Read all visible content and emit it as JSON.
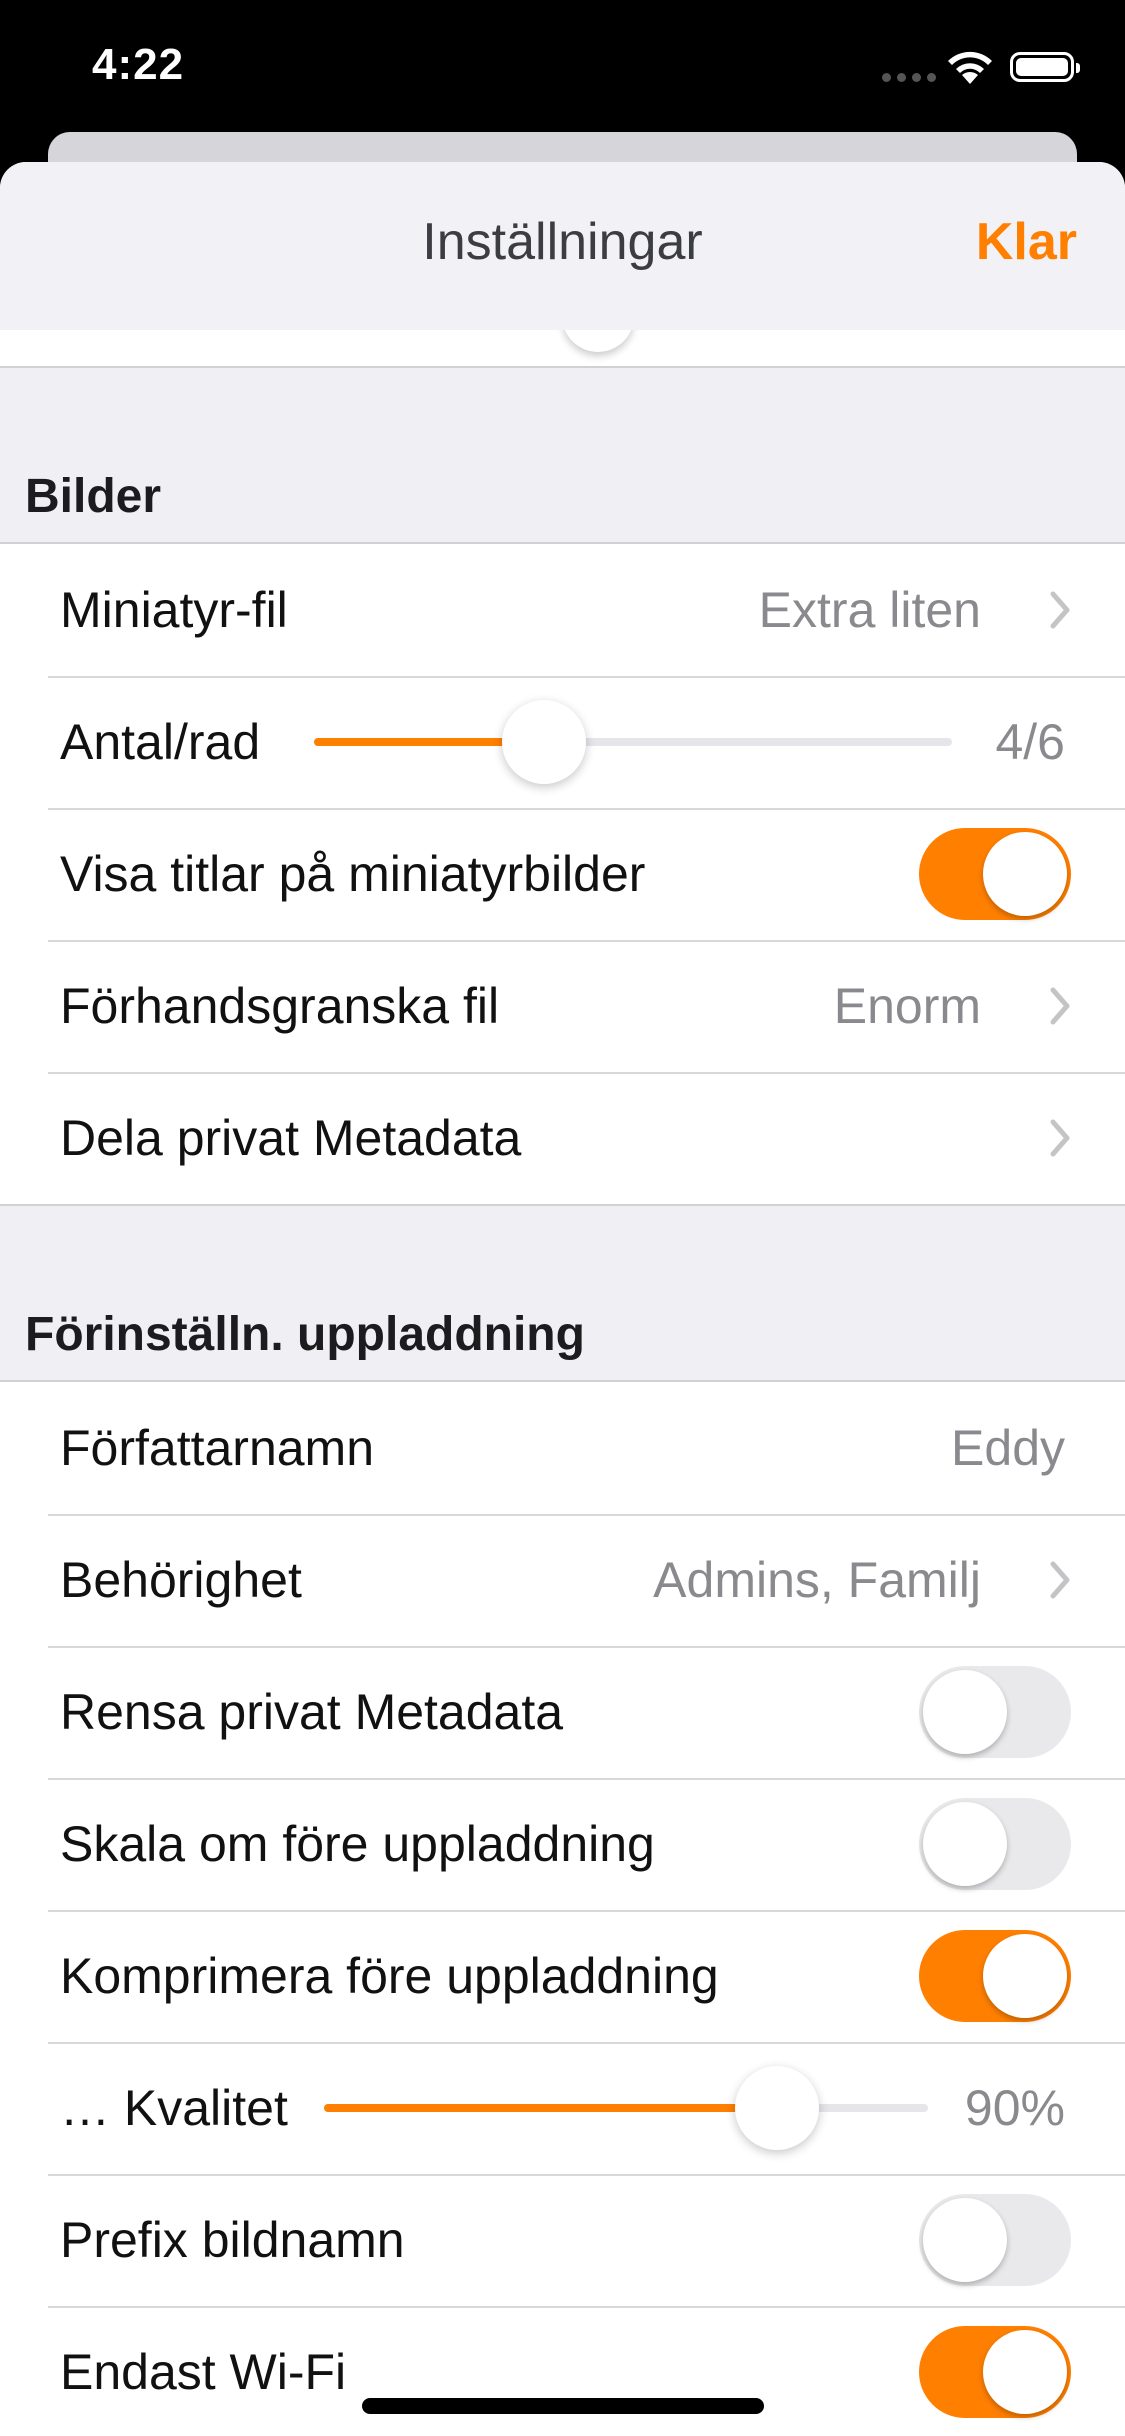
{
  "status_bar": {
    "time": "4:22"
  },
  "nav": {
    "title": "Inställningar",
    "done_label": "Klar"
  },
  "colors": {
    "accent": "#ff7f00",
    "toggle_off": "#e9e9eb",
    "separator": "#d0d0d5"
  },
  "sections": {
    "images": {
      "header": "Bilder",
      "thumbnail_file": {
        "label": "Miniatyr-fil",
        "value": "Extra liten",
        "icon": "chevron-right-icon"
      },
      "per_row": {
        "label": "Antal/rad",
        "value": "4/6",
        "level": 0.36
      },
      "show_titles": {
        "label": "Visa titlar på miniatyrbilder",
        "on": true
      },
      "preview_file": {
        "label": "Förhandsgranska fil",
        "value": "Enorm",
        "icon": "chevron-right-icon"
      },
      "share_private_metadata": {
        "label": "Dela privat Metadata",
        "icon": "chevron-right-icon"
      }
    },
    "upload": {
      "header": "Förinställn. uppladdning",
      "author_name": {
        "label": "Författarnamn",
        "value": "Eddy"
      },
      "permission": {
        "label": "Behörighet",
        "value": "Admins, Familj",
        "icon": "chevron-right-icon"
      },
      "strip_private_metadata": {
        "label": "Rensa privat Metadata",
        "on": false
      },
      "resize_before_upload": {
        "label": "Skala om före uppladdning",
        "on": false
      },
      "compress_before_upload": {
        "label": "Komprimera före uppladdning",
        "on": true
      },
      "quality": {
        "label": "… Kvalitet",
        "value": "90%",
        "level": 0.75
      },
      "prefix_filename": {
        "label": "Prefix bildnamn",
        "on": false
      },
      "wifi_only": {
        "label": "Endast Wi-Fi",
        "on": true
      }
    }
  }
}
